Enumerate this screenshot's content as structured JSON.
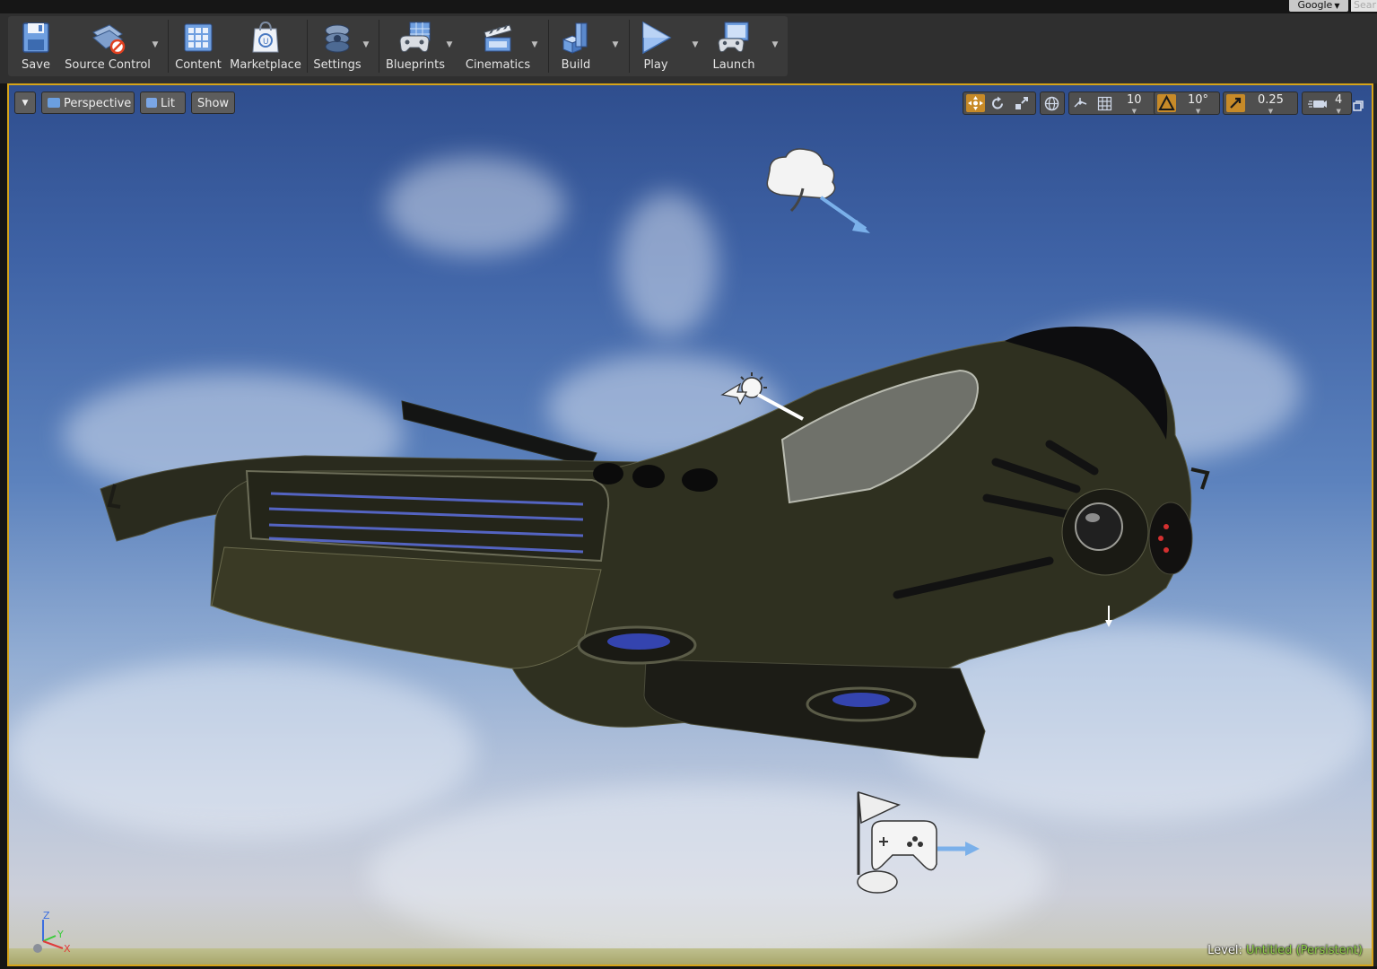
{
  "topbar": {
    "search_provider": "Google",
    "search_placeholder": "Sear"
  },
  "toolbar": {
    "buttons": [
      {
        "label": "Save",
        "icon": "save-icon",
        "dropdown": false
      },
      {
        "label": "Source Control",
        "icon": "source-control-icon",
        "dropdown": true
      },
      {
        "label": "Content",
        "icon": "content-icon",
        "dropdown": false
      },
      {
        "label": "Marketplace",
        "icon": "marketplace-icon",
        "dropdown": false
      },
      {
        "label": "Settings",
        "icon": "settings-icon",
        "dropdown": true
      },
      {
        "label": "Blueprints",
        "icon": "blueprints-icon",
        "dropdown": true
      },
      {
        "label": "Cinematics",
        "icon": "cinematics-icon",
        "dropdown": true
      },
      {
        "label": "Build",
        "icon": "build-icon",
        "dropdown": true
      },
      {
        "label": "Play",
        "icon": "play-icon",
        "dropdown": true
      },
      {
        "label": "Launch",
        "icon": "launch-icon",
        "dropdown": true
      }
    ]
  },
  "viewport": {
    "view_mode": "Perspective",
    "lighting_mode": "Lit",
    "show_label": "Show",
    "grid_snap_value": "10",
    "rotation_snap_value": "10°",
    "scale_snap_value": "0.25",
    "camera_speed_value": "4",
    "level_label": "Level:",
    "level_name": "Untitled (Persistent)",
    "axis_labels": {
      "z": "Z",
      "y": "Y",
      "x": "X"
    },
    "colors": {
      "selection_border": "#d6a419",
      "sky_top": "#2f4e8e",
      "sky_horizon": "#cccfd9",
      "level_name": "#8fd14a",
      "active_tool": "#c78a28"
    }
  }
}
